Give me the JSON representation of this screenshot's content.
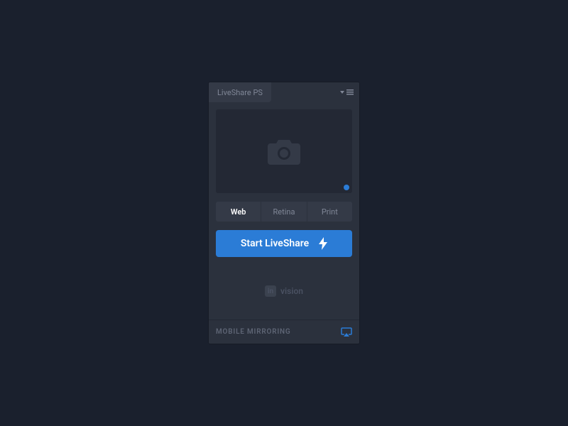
{
  "titlebar": {
    "tab": "LiveShare PS"
  },
  "segments": {
    "items": [
      "Web",
      "Retina",
      "Print"
    ],
    "active": 0
  },
  "primary": {
    "label": "Start LiveShare"
  },
  "brand": {
    "prefix": "in",
    "suffix": "vision"
  },
  "footer": {
    "label": "MOBILE MIRRORING"
  },
  "colors": {
    "accent": "#2b7cd6"
  }
}
